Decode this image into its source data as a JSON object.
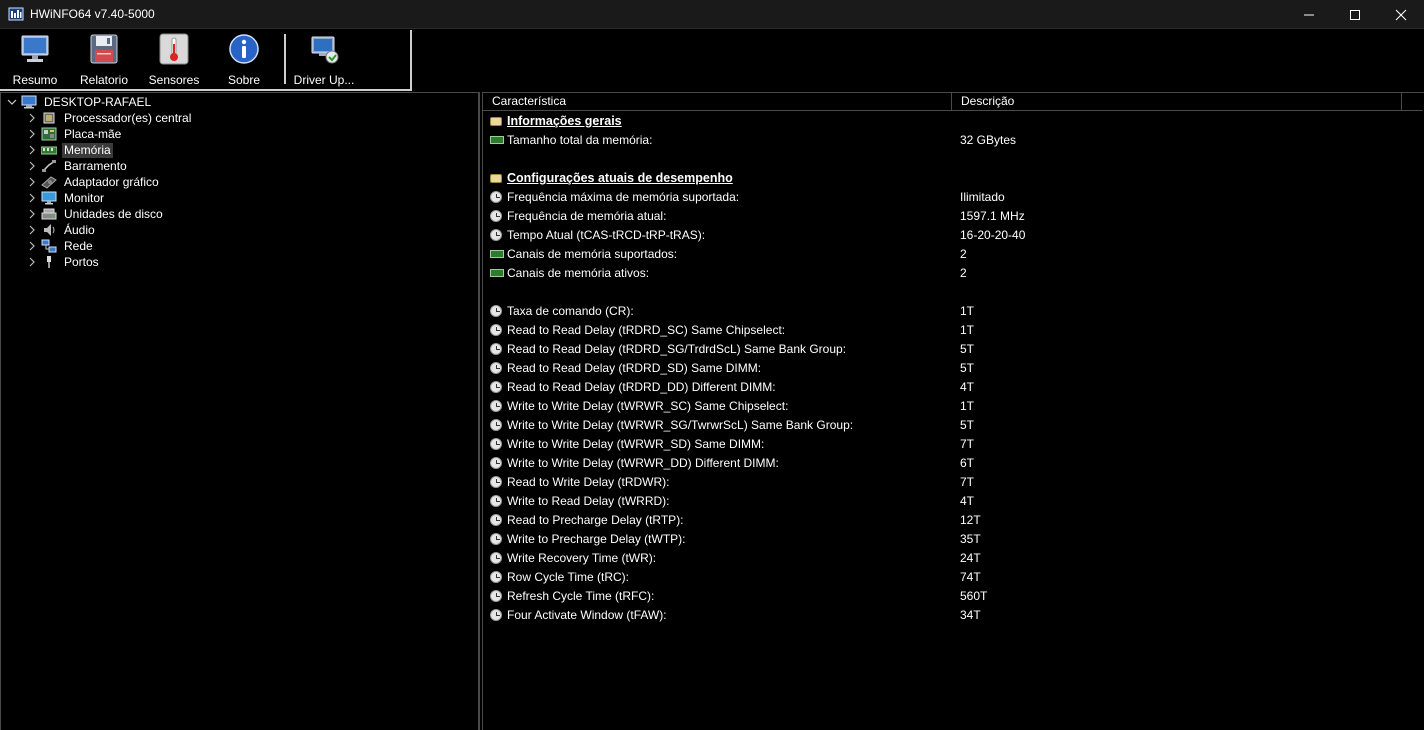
{
  "window": {
    "title": "HWiNFO64 v7.40-5000"
  },
  "toolbar": {
    "buttons": [
      {
        "label": "Resumo",
        "icon": "monitor-icon"
      },
      {
        "label": "Relatorio",
        "icon": "floppy-disk-icon"
      },
      {
        "label": "Sensores",
        "icon": "thermometer-icon"
      },
      {
        "label": "Sobre",
        "icon": "info-icon"
      },
      {
        "label": "Driver Up...",
        "icon": "driver-update-icon"
      }
    ]
  },
  "tree": {
    "root": {
      "label": "DESKTOP-RAFAEL",
      "icon": "computer-icon"
    },
    "items": [
      {
        "label": "Processador(es) central",
        "icon": "cpu-icon"
      },
      {
        "label": "Placa-mãe",
        "icon": "motherboard-icon"
      },
      {
        "label": "Memória",
        "icon": "ram-icon",
        "selected": true
      },
      {
        "label": "Barramento",
        "icon": "bus-icon"
      },
      {
        "label": "Adaptador gráfico",
        "icon": "gpu-icon"
      },
      {
        "label": "Monitor",
        "icon": "monitor-icon"
      },
      {
        "label": "Unidades de disco",
        "icon": "disk-icon"
      },
      {
        "label": "Áudio",
        "icon": "speaker-icon"
      },
      {
        "label": "Rede",
        "icon": "network-icon"
      },
      {
        "label": "Portos",
        "icon": "port-icon"
      }
    ]
  },
  "details": {
    "columns": {
      "feature": "Característica",
      "description": "Descrição"
    },
    "sections": {
      "general": "Informações gerais",
      "performance": "Configurações atuais de desempenho"
    },
    "general_rows": [
      {
        "feature": "Tamanho total da memória:",
        "value": "32 GBytes",
        "icon": "ram-icon"
      }
    ],
    "perf_rows_a": [
      {
        "feature": "Frequência máxima de memória suportada:",
        "value": "Ilimitado",
        "icon": "clock-icon"
      },
      {
        "feature": "Frequência de memória atual:",
        "value": "1597.1 MHz",
        "icon": "clock-icon"
      },
      {
        "feature": "Tempo Atual (tCAS-tRCD-tRP-tRAS):",
        "value": "16-20-20-40",
        "icon": "clock-icon"
      },
      {
        "feature": "Canais de memória suportados:",
        "value": "2",
        "icon": "ram-icon"
      },
      {
        "feature": "Canais de memória ativos:",
        "value": "2",
        "icon": "ram-icon"
      }
    ],
    "perf_rows_b": [
      {
        "feature": "Taxa de comando (CR):",
        "value": "1T",
        "icon": "clock-icon"
      },
      {
        "feature": "Read to Read Delay (tRDRD_SC) Same Chipselect:",
        "value": "1T",
        "icon": "clock-icon"
      },
      {
        "feature": "Read to Read Delay (tRDRD_SG/TrdrdScL) Same Bank Group:",
        "value": "5T",
        "icon": "clock-icon"
      },
      {
        "feature": "Read to Read Delay (tRDRD_SD) Same DIMM:",
        "value": "5T",
        "icon": "clock-icon"
      },
      {
        "feature": "Read to Read Delay (tRDRD_DD) Different DIMM:",
        "value": "4T",
        "icon": "clock-icon"
      },
      {
        "feature": "Write to Write Delay (tWRWR_SC) Same Chipselect:",
        "value": "1T",
        "icon": "clock-icon"
      },
      {
        "feature": "Write to Write Delay (tWRWR_SG/TwrwrScL) Same Bank Group:",
        "value": "5T",
        "icon": "clock-icon"
      },
      {
        "feature": "Write to Write Delay (tWRWR_SD) Same DIMM:",
        "value": "7T",
        "icon": "clock-icon"
      },
      {
        "feature": "Write to Write Delay (tWRWR_DD) Different DIMM:",
        "value": "6T",
        "icon": "clock-icon"
      },
      {
        "feature": "Read to Write Delay (tRDWR):",
        "value": "7T",
        "icon": "clock-icon"
      },
      {
        "feature": "Write to Read Delay (tWRRD):",
        "value": "4T",
        "icon": "clock-icon"
      },
      {
        "feature": "Read to Precharge Delay (tRTP):",
        "value": "12T",
        "icon": "clock-icon"
      },
      {
        "feature": "Write to Precharge Delay (tWTP):",
        "value": "35T",
        "icon": "clock-icon"
      },
      {
        "feature": "Write Recovery Time (tWR):",
        "value": "24T",
        "icon": "clock-icon"
      },
      {
        "feature": "Row Cycle Time (tRC):",
        "value": "74T",
        "icon": "clock-icon"
      },
      {
        "feature": "Refresh Cycle Time (tRFC):",
        "value": "560T",
        "icon": "clock-icon"
      },
      {
        "feature": "Four Activate Window (tFAW):",
        "value": "34T",
        "icon": "clock-icon"
      }
    ]
  }
}
